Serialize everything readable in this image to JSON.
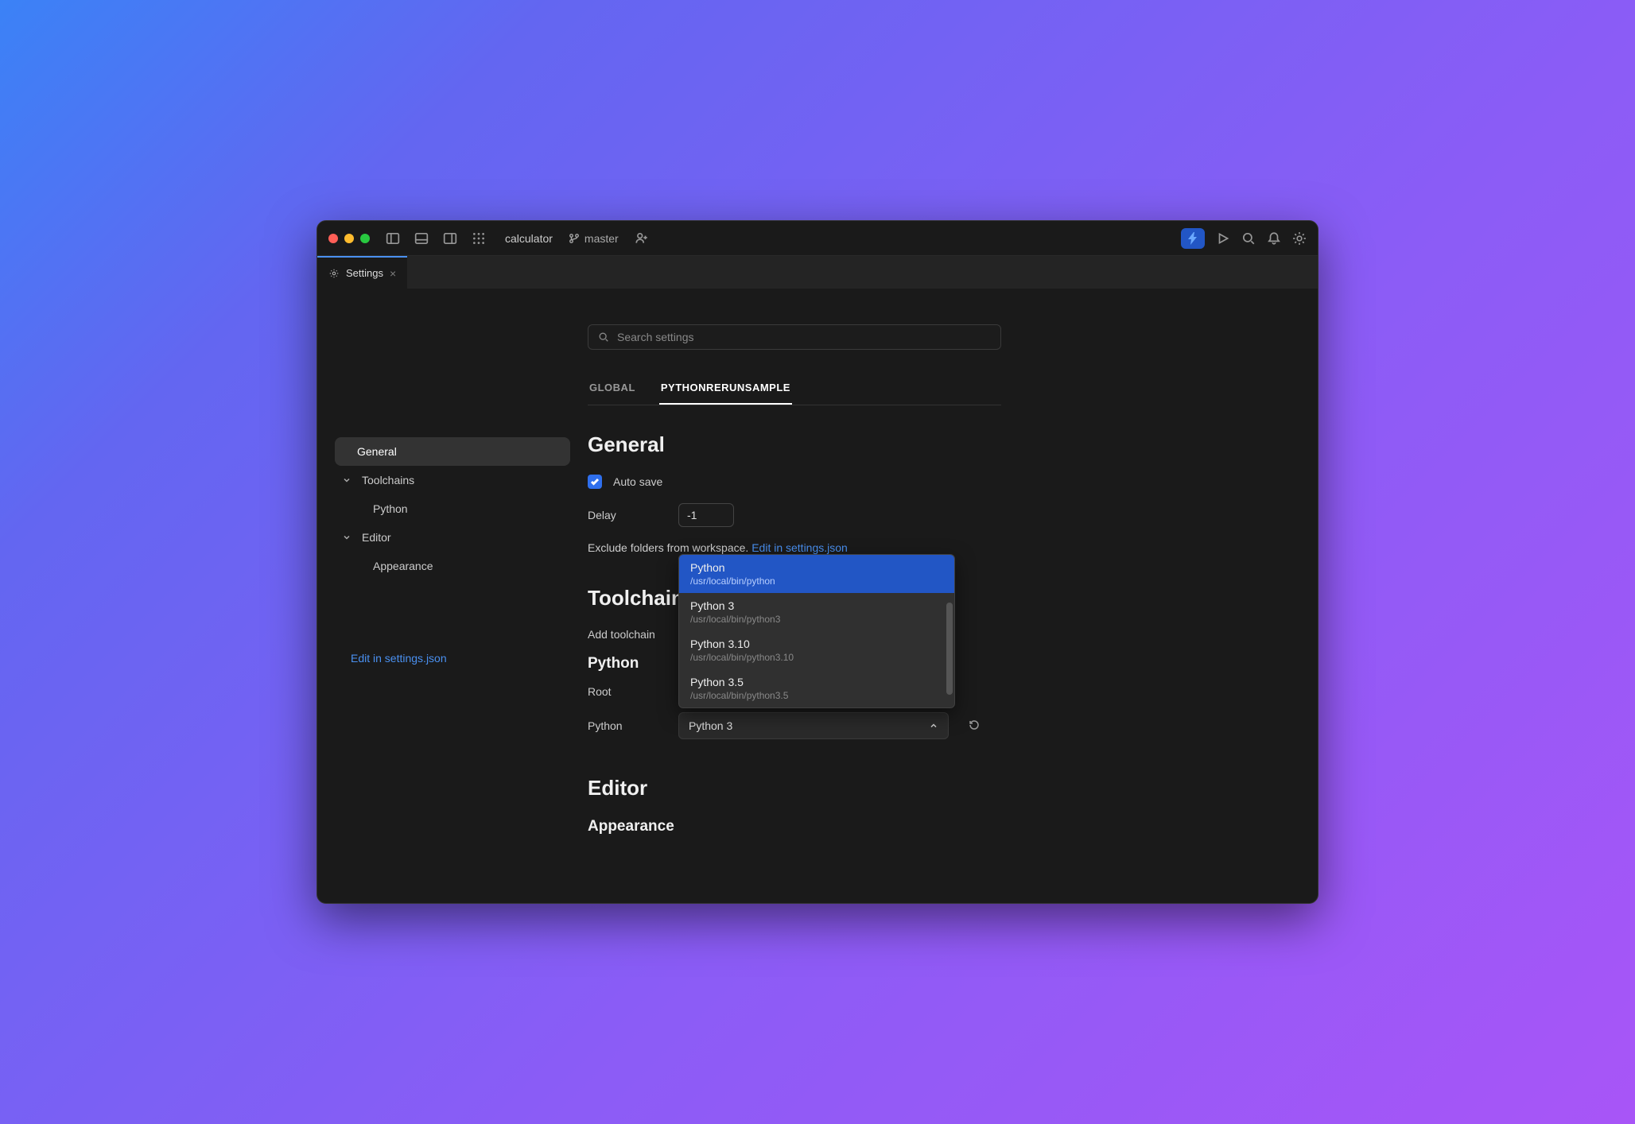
{
  "titlebar": {
    "project": "calculator",
    "branch": "master"
  },
  "tab": {
    "title": "Settings"
  },
  "sidebar": {
    "items": {
      "general": "General",
      "toolchains": "Toolchains",
      "python": "Python",
      "editor": "Editor",
      "appearance": "Appearance"
    },
    "edit_link": "Edit in settings.json"
  },
  "search": {
    "placeholder": "Search settings"
  },
  "scope_tabs": {
    "global": "GLOBAL",
    "project": "PYTHONRERUNSAMPLE"
  },
  "general": {
    "heading": "General",
    "autosave_label": "Auto save",
    "autosave_checked": true,
    "delay_label": "Delay",
    "delay_value": "-1",
    "exclude_text": "Exclude folders from workspace.",
    "exclude_link": "Edit in settings.json"
  },
  "toolchains": {
    "heading": "Toolchains",
    "add_label": "Add toolchain",
    "python_heading": "Python",
    "root_label": "Root",
    "selector_label": "Python",
    "selected_value": "Python 3",
    "options": [
      {
        "name": "Python",
        "path": "/usr/local/bin/python"
      },
      {
        "name": "Python 3",
        "path": "/usr/local/bin/python3"
      },
      {
        "name": "Python 3.10",
        "path": "/usr/local/bin/python3.10"
      },
      {
        "name": "Python 3.5",
        "path": "/usr/local/bin/python3.5"
      }
    ]
  },
  "editor": {
    "heading": "Editor",
    "appearance_heading": "Appearance"
  }
}
